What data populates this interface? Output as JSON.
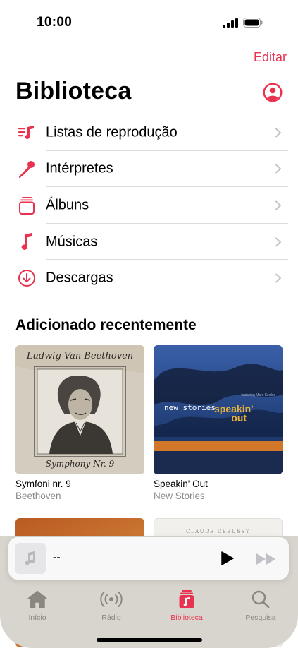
{
  "status_bar": {
    "time": "10:00"
  },
  "header": {
    "edit_label": "Editar",
    "title": "Biblioteca",
    "account_icon": "person-circle-icon"
  },
  "library": {
    "items": [
      {
        "label": "Listas de reprodução",
        "icon": "playlist-icon"
      },
      {
        "label": "Intérpretes",
        "icon": "microphone-icon"
      },
      {
        "label": "Álbuns",
        "icon": "album-stack-icon"
      },
      {
        "label": "Músicas",
        "icon": "music-note-icon"
      },
      {
        "label": "Descargas",
        "icon": "download-circle-icon"
      }
    ]
  },
  "recent": {
    "title": "Adicionado recentemente",
    "albums": [
      {
        "title": "Symfoni nr. 9",
        "artist": "Beethoven",
        "cover_text_top": "Ludwig Van Beethoven",
        "cover_text_bottom": "Symphony Nr. 9"
      },
      {
        "title": "Speakin' Out",
        "artist": "New Stories",
        "cover_text_band": "new stories",
        "cover_text_title": "speakin' out",
        "cover_text_small": "featuring Marc Seales"
      },
      {
        "title": "",
        "artist": ""
      },
      {
        "title": "",
        "artist": "",
        "cover_text_top": "CLAUDE DEBUSSY"
      }
    ]
  },
  "mini_player": {
    "title": "--",
    "play_icon": "play-icon",
    "forward_icon": "forward-icon"
  },
  "tabs": [
    {
      "label": "Início",
      "icon": "house-icon",
      "active": false
    },
    {
      "label": "Rádio",
      "icon": "radio-waves-icon",
      "active": false
    },
    {
      "label": "Biblioteca",
      "icon": "library-icon",
      "active": true
    },
    {
      "label": "Pesquisa",
      "icon": "search-icon",
      "active": false
    }
  ],
  "colors": {
    "accent": "#e8324f",
    "secondary_text": "#8a8a8e",
    "tab_bar": "#d8d5ce"
  }
}
